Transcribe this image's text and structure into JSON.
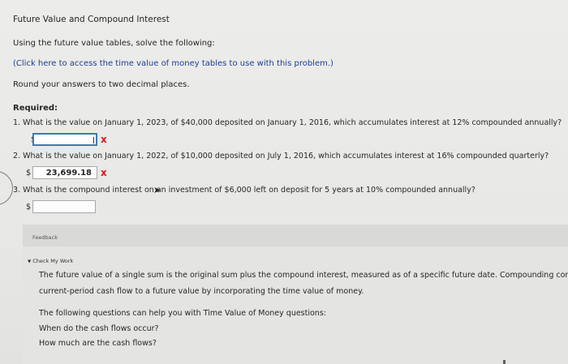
{
  "page": {
    "title": "Future Value and Compound Interest",
    "instruction": "Using the future value tables, solve the following:",
    "link_text": "(Click here to access the time value of money tables to use with this problem.)",
    "round_note": "Round your answers to two decimal places.",
    "required_label": "Required:"
  },
  "questions": [
    {
      "text": "1. What is the value on January 1, 2023, of $40,000 deposited on January 1, 2016, which accumulates interest at 12% compounded annually?",
      "currency": "$",
      "answer": "",
      "result": "x"
    },
    {
      "text": "2. What is the value on January 1, 2022, of $10,000 deposited on July 1, 2016, which accumulates interest at 16% compounded quarterly?",
      "currency": "$",
      "answer": "23,699.18",
      "result": "x"
    },
    {
      "text": "3. What is the compound interest on an investment of $6,000 left on deposit for 5 years at 10% compounded annually?",
      "currency": "$",
      "answer": ""
    }
  ],
  "feedback": {
    "label": "Feedback",
    "check_label": "Check My Work",
    "paragraph_1_line_1": "The future value of a single sum is the original sum plus the compound interest, measured as of a specific future date. Compounding convert",
    "paragraph_1_line_2": "current-period cash flow to a future value by incorporating the time value of money.",
    "paragraph_2_line_1": "The following questions can help you with Time Value of Money questions:",
    "paragraph_2_line_2": "When do the cash flows occur?",
    "paragraph_2_line_3": "How much are the cash flows?"
  },
  "colors": {
    "link": "#1d3f8f",
    "incorrect": "#d01e1e",
    "active_border": "#3f79b3"
  },
  "icons": {
    "incorrect_mark": "x",
    "expand_triangle": "▼",
    "mouse_pointer": "➤"
  }
}
